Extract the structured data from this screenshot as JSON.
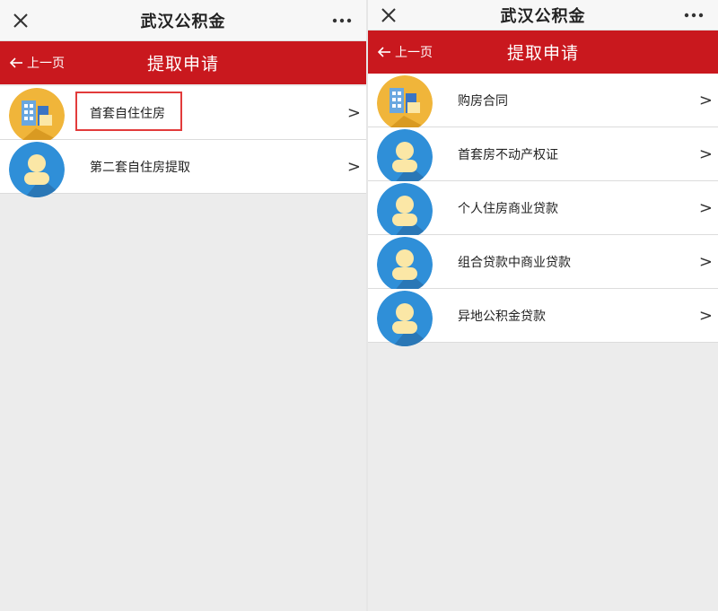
{
  "left": {
    "app_title": "武汉公积金",
    "back_label": "上一页",
    "page_title": "提取申请",
    "items": [
      {
        "label": "首套自住住房",
        "icon": "building-icon",
        "arrow": ">"
      },
      {
        "label": "第二套自住房提取",
        "icon": "person-icon",
        "arrow": ">"
      }
    ]
  },
  "right": {
    "app_title": "武汉公积金",
    "back_label": "上一页",
    "page_title": "提取申请",
    "items": [
      {
        "label": "购房合同",
        "icon": "building-icon",
        "arrow": ">"
      },
      {
        "label": "首套房不动产权证",
        "icon": "person-icon",
        "arrow": ">"
      },
      {
        "label": "个人住房商业贷款",
        "icon": "person-icon",
        "arrow": ">"
      },
      {
        "label": "组合贷款中商业贷款",
        "icon": "person-icon",
        "arrow": ">"
      },
      {
        "label": "异地公积金贷款",
        "icon": "person-icon",
        "arrow": ">"
      }
    ]
  },
  "colors": {
    "nav_red": "#c9181e",
    "icon_yellow": "#f0b53a",
    "icon_blue": "#2f8fd8",
    "highlight_red": "#e23b3b"
  }
}
